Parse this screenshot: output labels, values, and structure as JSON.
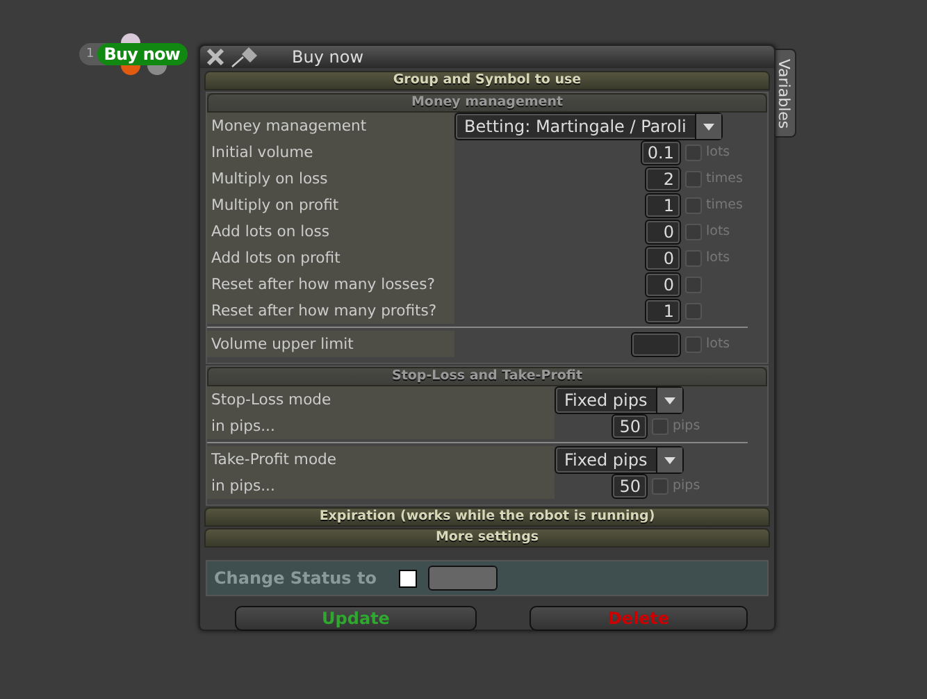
{
  "node": {
    "index": "1",
    "label": "Buy now"
  },
  "window": {
    "title": "Buy now",
    "side_tab": "Variables"
  },
  "panels": [
    {
      "kind": "header",
      "title": "Group and Symbol to use"
    },
    {
      "kind": "narrow",
      "title": "Money management",
      "blocks": [
        [
          {
            "kind": "select",
            "label": "Money management",
            "value": "Betting: Martingale / Paroli"
          },
          {
            "kind": "number",
            "label": "Initial volume",
            "value": "0.1",
            "checked": false,
            "unit": "lots"
          },
          {
            "kind": "number",
            "label": "Multiply on loss",
            "value": "2",
            "checked": false,
            "unit": "times"
          },
          {
            "kind": "number",
            "label": "Multiply on profit",
            "value": "1",
            "checked": false,
            "unit": "times"
          },
          {
            "kind": "number",
            "label": "Add lots on loss",
            "value": "0",
            "checked": false,
            "unit": "lots"
          },
          {
            "kind": "number",
            "label": "Add lots on profit",
            "value": "0",
            "checked": false,
            "unit": "lots"
          },
          {
            "kind": "number",
            "label": "Reset after how many losses?",
            "value": "0",
            "checked": false
          },
          {
            "kind": "number",
            "label": "Reset after how many profits?",
            "value": "1",
            "checked": false
          }
        ],
        [
          {
            "kind": "number",
            "label": "Volume upper limit",
            "checked": false,
            "unit": "lots"
          }
        ]
      ]
    },
    {
      "kind": "wide",
      "title": "Stop-Loss and Take-Profit",
      "blocks": [
        [
          {
            "kind": "select",
            "label": "Stop-Loss mode",
            "value": "Fixed pips"
          },
          {
            "kind": "number",
            "label": "in pips...",
            "value": "50",
            "checked": false,
            "unit": "pips"
          }
        ],
        [
          {
            "kind": "select",
            "label": "Take-Profit mode",
            "value": "Fixed pips"
          },
          {
            "kind": "number",
            "label": "in pips...",
            "value": "50",
            "checked": false,
            "unit": "pips"
          }
        ]
      ]
    },
    {
      "kind": "header",
      "title": "Expiration (works while the robot is running)"
    },
    {
      "kind": "header",
      "title": "More settings"
    }
  ],
  "status": {
    "label": "Change Status to",
    "checked": false
  },
  "buttons": [
    {
      "label": "Update",
      "kind": "ok"
    },
    {
      "label": "Delete",
      "kind": "danger"
    }
  ]
}
